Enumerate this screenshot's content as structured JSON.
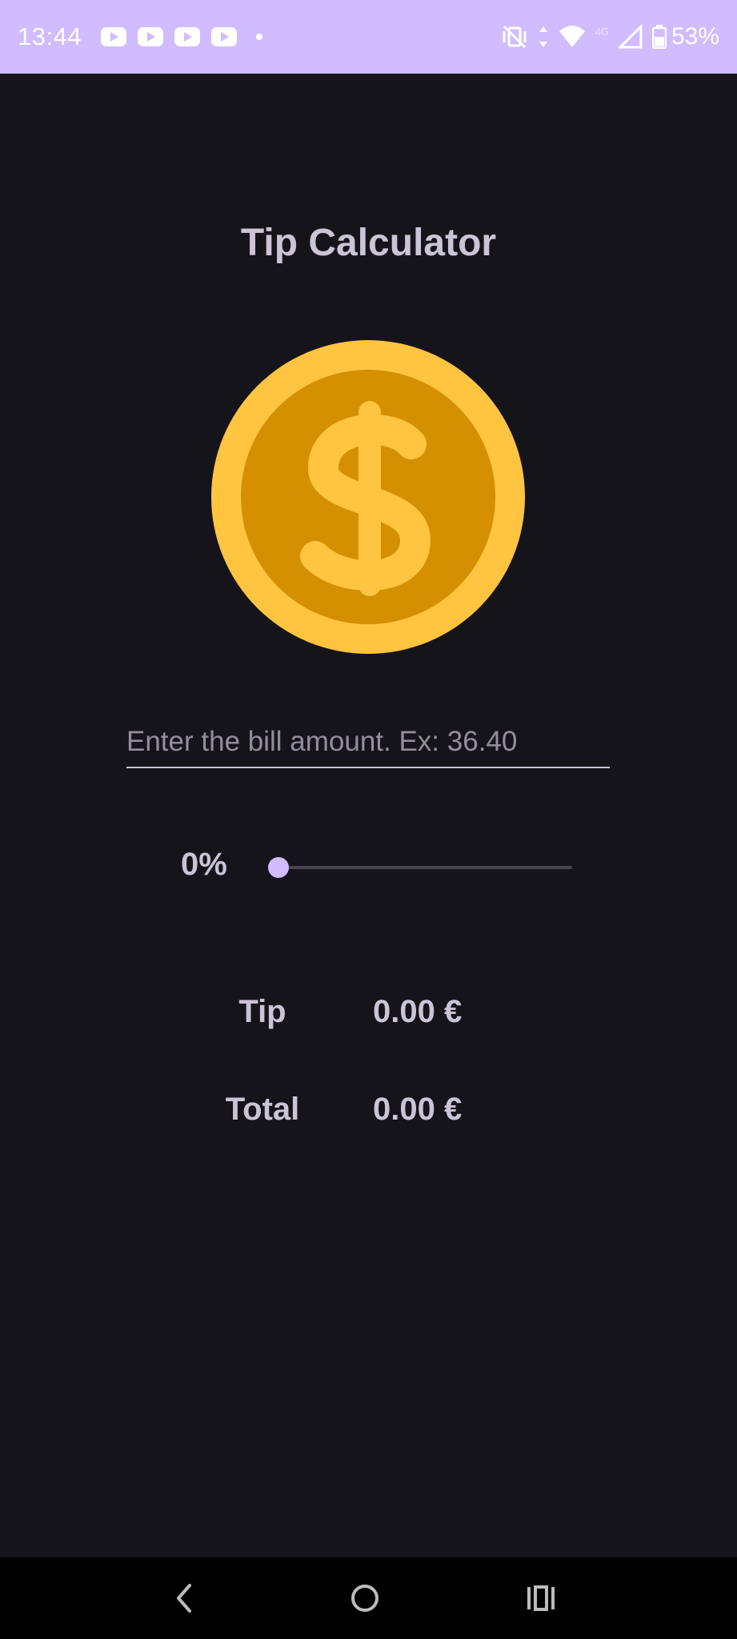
{
  "status_bar": {
    "time": "13:44",
    "notification_icons": [
      "youtube-icon",
      "youtube-icon",
      "youtube-icon",
      "youtube-icon"
    ],
    "signal_label": "4G",
    "battery": "53%"
  },
  "app": {
    "title": "Tip Calculator",
    "bill_input": {
      "value": "",
      "placeholder": "Enter the bill amount. Ex: 36.40"
    },
    "tip_slider": {
      "label": "0%",
      "value": 0
    },
    "results": {
      "tip_label": "Tip",
      "tip_value": "0.00 €",
      "total_label": "Total",
      "total_value": "0.00 €"
    }
  },
  "colors": {
    "background": "#16141b",
    "status_bar": "#d0bcfe",
    "text": "#cbc4d6",
    "coin_outer": "#ffc440",
    "coin_inner": "#d49000",
    "accent": "#d0bcfe"
  }
}
